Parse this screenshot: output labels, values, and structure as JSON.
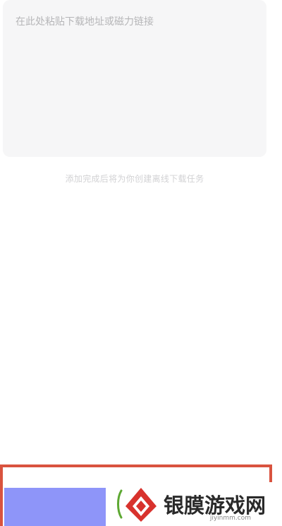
{
  "input": {
    "placeholder": "在此处粘贴下载地址或磁力链接",
    "value": ""
  },
  "hint_text": "添加完成后将为你创建离线下载任务",
  "watermark": {
    "brand": "银膜游戏网",
    "domain": "jiyinmm.com"
  },
  "colors": {
    "input_background": "#f6f6f7",
    "button": "#8e95f9",
    "highlight_border": "#d9533f",
    "logo_red": "#d8322d",
    "logo_green": "#5da832"
  }
}
